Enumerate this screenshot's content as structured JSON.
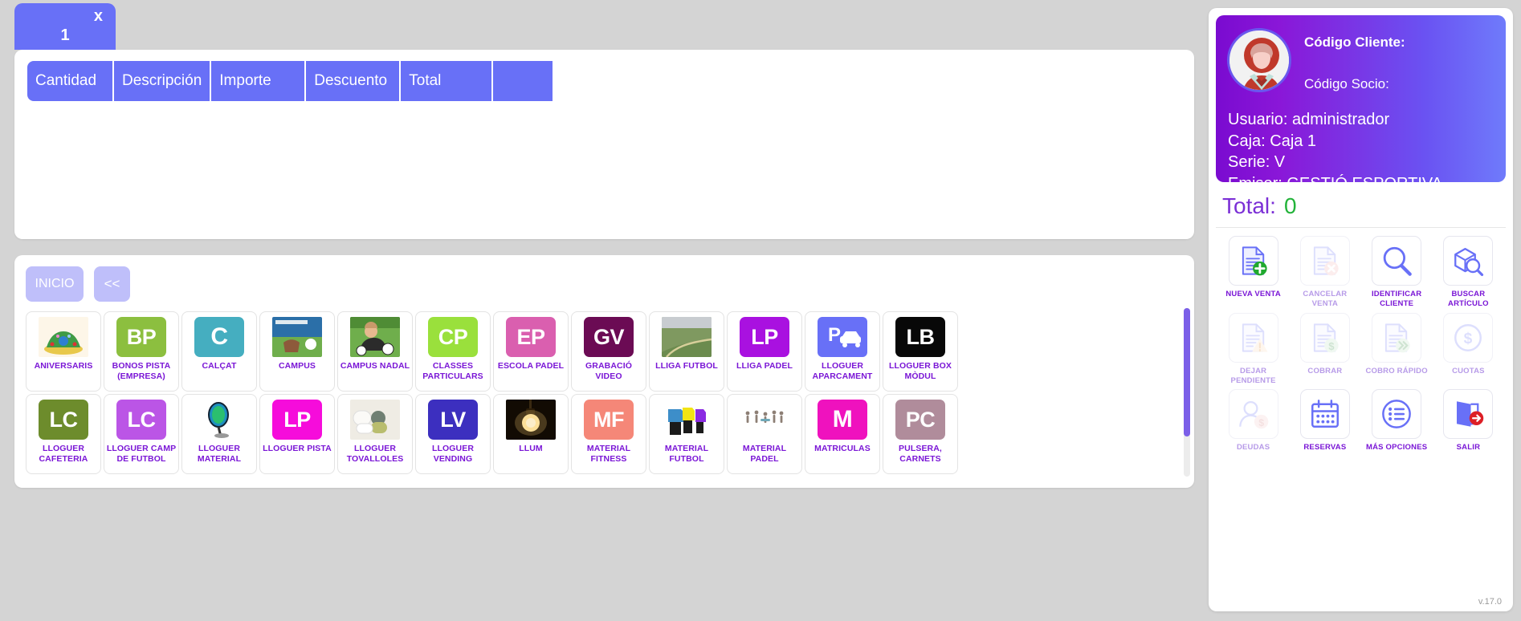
{
  "tab": {
    "label": "1",
    "close": "x"
  },
  "sale_table": {
    "columns": [
      {
        "key": "cantidad",
        "label": "Cantidad"
      },
      {
        "key": "descripcion",
        "label": "Descripción"
      },
      {
        "key": "importe",
        "label": "Importe"
      },
      {
        "key": "descuento",
        "label": "Descuento"
      },
      {
        "key": "total",
        "label": "Total"
      },
      {
        "key": "blank",
        "label": ""
      }
    ],
    "rows": []
  },
  "nav": {
    "inicio": "INICIO",
    "back": "<<"
  },
  "products": [
    {
      "label": "ANIVERSARIS",
      "initials": "",
      "color": "#f0e0c8",
      "photo": "cake"
    },
    {
      "label": "BONOS PISTA (EMPRESA)",
      "initials": "BP",
      "color": "#8cbf3f"
    },
    {
      "label": "CALÇAT",
      "initials": "C",
      "color": "#45aec0"
    },
    {
      "label": "CAMPUS",
      "initials": "",
      "color": "#7ba05b",
      "photo": "campus"
    },
    {
      "label": "CAMPUS NADAL",
      "initials": "",
      "color": "#86a05a",
      "photo": "boy"
    },
    {
      "label": "CLASSES PARTICULARS",
      "initials": "CP",
      "color": "#9ae03c"
    },
    {
      "label": "ESCOLA PADEL",
      "initials": "EP",
      "color": "#da5faf"
    },
    {
      "label": "GRABACIÓ VIDEO",
      "initials": "GV",
      "color": "#6b0b54"
    },
    {
      "label": "LLIGA FUTBOL",
      "initials": "",
      "color": "#7f9960",
      "photo": "field"
    },
    {
      "label": "LLIGA PADEL",
      "initials": "LP",
      "color": "#a911e0"
    },
    {
      "label": "LLOGUER APARCAMENT",
      "initials": "",
      "color": "#6870f7",
      "photo": "parking"
    },
    {
      "label": "LLOGUER BOX MÒDUL",
      "initials": "LB",
      "color": "#080808"
    },
    {
      "label": "LLOGUER CAFETERIA",
      "initials": "LC",
      "color": "#6d8c2c"
    },
    {
      "label": "LLOGUER CAMP DE FUTBOL",
      "initials": "LC",
      "color": "#bb55e6"
    },
    {
      "label": "LLOGUER MATERIAL",
      "initials": "",
      "color": "#ffffff",
      "photo": "racket"
    },
    {
      "label": "LLOGUER PISTA",
      "initials": "LP",
      "color": "#f60cdb"
    },
    {
      "label": "LLOGUER TOVALLOLES",
      "initials": "",
      "color": "#e8e6de",
      "photo": "towels"
    },
    {
      "label": "LLOGUER VENDING",
      "initials": "LV",
      "color": "#3c2fbf"
    },
    {
      "label": "LLUM",
      "initials": "",
      "color": "#120b03",
      "photo": "bulb"
    },
    {
      "label": "MATERIAL FITNESS",
      "initials": "MF",
      "color": "#f58778"
    },
    {
      "label": "MATERIAL FUTBOL",
      "initials": "",
      "color": "#ffffff",
      "photo": "kits"
    },
    {
      "label": "MATERIAL PADEL",
      "initials": "",
      "color": "#ffffff",
      "photo": "people"
    },
    {
      "label": "MATRICULAS",
      "initials": "M",
      "color": "#ef12be"
    },
    {
      "label": "PULSERA, CARNETS",
      "initials": "PC",
      "color": "#b08c9b"
    }
  ],
  "client": {
    "codigo_cliente_label": "Código Cliente:",
    "codigo_socio_label": "Código Socio:",
    "usuario": "Usuario: administrador",
    "caja": "Caja: Caja 1",
    "serie": "Serie: V",
    "emisor": "Emisor: GESTIÓ ESPORTIVA"
  },
  "total": {
    "label": "Total:",
    "value": "0",
    "value_color": "#23b33a"
  },
  "actions": [
    [
      {
        "label": "NUEVA VENTA",
        "icon": "doc-add-icon",
        "enabled": true
      },
      {
        "label": "CANCELAR VENTA",
        "icon": "doc-cancel-icon",
        "enabled": false
      },
      {
        "label": "IDENTIFICAR CLIENTE",
        "icon": "magnifier-icon",
        "enabled": true
      },
      {
        "label": "BUSCAR ARTÍCULO",
        "icon": "box-search-icon",
        "enabled": true
      }
    ],
    [
      {
        "label": "DEJAR PENDIENTE",
        "icon": "doc-warning-icon",
        "enabled": false
      },
      {
        "label": "COBRAR",
        "icon": "doc-money-icon",
        "enabled": false
      },
      {
        "label": "COBRO RÁPIDO",
        "icon": "doc-fast-icon",
        "enabled": false
      },
      {
        "label": "CUOTAS",
        "icon": "coin-dollar-icon",
        "enabled": false
      }
    ],
    [
      {
        "label": "DEUDAS",
        "icon": "user-money-icon",
        "enabled": false
      },
      {
        "label": "RESERVAS",
        "icon": "calendar-icon",
        "enabled": true
      },
      {
        "label": "MÁS OPCIONES",
        "icon": "list-circle-icon",
        "enabled": true
      },
      {
        "label": "SALIR",
        "icon": "exit-door-icon",
        "enabled": true
      }
    ]
  ],
  "version": "v.17.0",
  "colors": {
    "primary": "#6870f7",
    "accent_purple": "#7a16d6",
    "success": "#23b33a"
  }
}
